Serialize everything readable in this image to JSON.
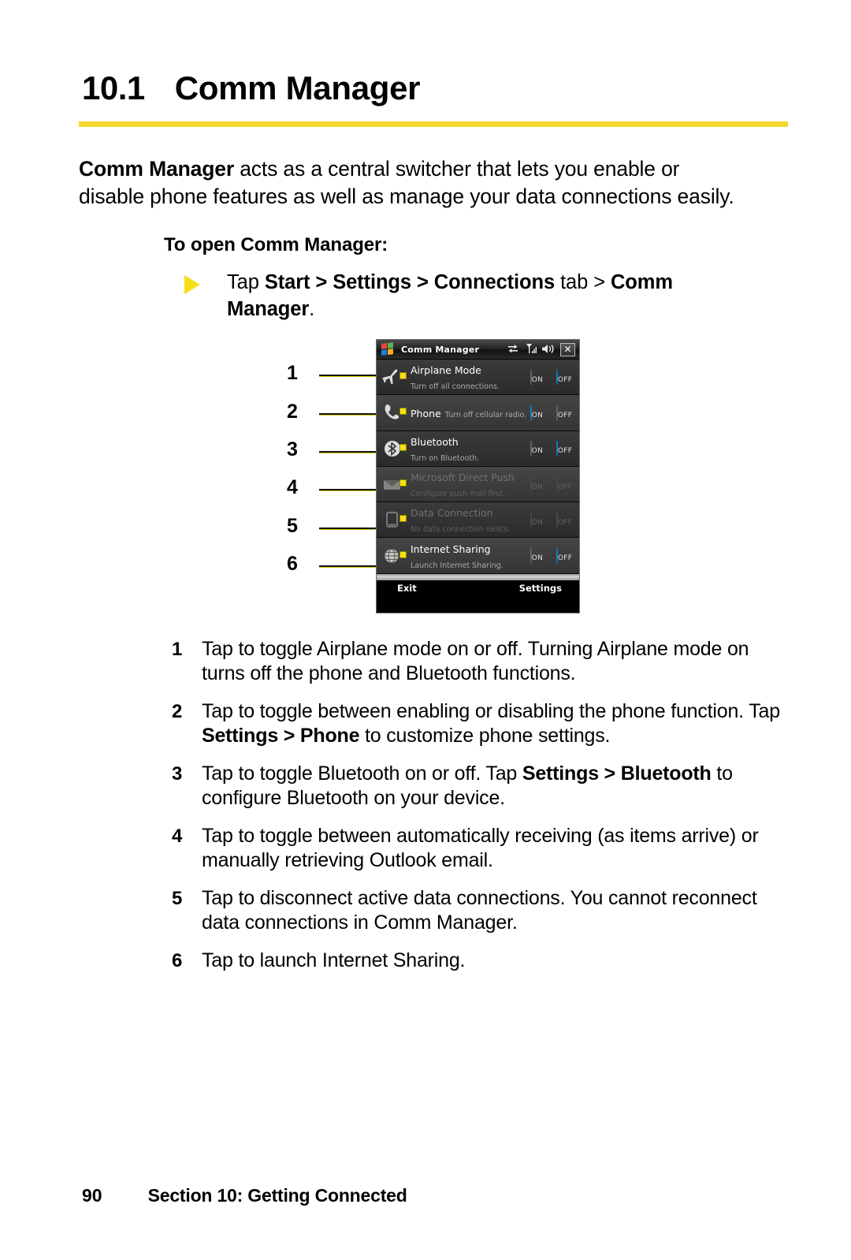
{
  "heading": {
    "number": "10.1",
    "title": "Comm Manager"
  },
  "intro": {
    "lead": "Comm Manager",
    "rest": " acts as a central switcher that lets you enable or disable phone features as well as manage your data connections easily."
  },
  "subhead": "To open Comm Manager:",
  "bullet": {
    "prefix": "Tap ",
    "b1": "Start",
    "sep1": " > ",
    "b2": "Settings",
    "sep2": " > ",
    "b3": "Connections",
    "mid": " tab > ",
    "b4": "Comm Manager",
    "suffix": "."
  },
  "callouts": [
    "1",
    "2",
    "3",
    "4",
    "5",
    "6"
  ],
  "device": {
    "titlebar": {
      "app_icon": "windows-logo-icon",
      "title": "Comm Manager",
      "tray": [
        "connectivity-icon",
        "signal-strength-icon",
        "volume-icon"
      ],
      "close_label": "✕"
    },
    "rows": [
      {
        "icon": "airplane-icon",
        "title": "Airplane Mode",
        "subtitle": "Turn off all connections.",
        "on_label": "ON",
        "off_label": "OFF",
        "state": "off",
        "disabled": false
      },
      {
        "icon": "phone-handset-icon",
        "title": "Phone",
        "subtitle": "Turn off cellular radio.",
        "on_label": "ON",
        "off_label": "OFF",
        "state": "on",
        "disabled": false
      },
      {
        "icon": "bluetooth-icon",
        "title": "Bluetooth",
        "subtitle": "Turn on Bluetooth.",
        "on_label": "ON",
        "off_label": "OFF",
        "state": "off",
        "disabled": false
      },
      {
        "icon": "envelope-icon",
        "title": "Microsoft Direct Push",
        "subtitle": "Configure push mail first.",
        "on_label": "ON",
        "off_label": "OFF",
        "state": "none",
        "disabled": true
      },
      {
        "icon": "pda-device-icon",
        "title": "Data Connection",
        "subtitle": "No data connection exists.",
        "on_label": "ON",
        "off_label": "OFF",
        "state": "none",
        "disabled": true
      },
      {
        "icon": "globe-icon",
        "title": "Internet Sharing",
        "subtitle": "Launch Internet Sharing.",
        "on_label": "ON",
        "off_label": "OFF",
        "state": "off",
        "disabled": false
      }
    ],
    "softkeys": {
      "left": "Exit",
      "right": "Settings"
    }
  },
  "steps": [
    {
      "num": "1",
      "parts": [
        {
          "t": "Tap to toggle Airplane mode on or off. Turning Airplane mode on turns off the phone and Bluetooth functions.",
          "b": false
        }
      ]
    },
    {
      "num": "2",
      "parts": [
        {
          "t": "Tap to toggle between enabling or disabling the phone function. Tap ",
          "b": false
        },
        {
          "t": "Settings > Phone",
          "b": true
        },
        {
          "t": " to customize phone settings.",
          "b": false
        }
      ]
    },
    {
      "num": "3",
      "parts": [
        {
          "t": "Tap to toggle Bluetooth on or off. Tap ",
          "b": false
        },
        {
          "t": "Settings > Bluetooth",
          "b": true
        },
        {
          "t": " to configure Bluetooth on your device.",
          "b": false
        }
      ]
    },
    {
      "num": "4",
      "parts": [
        {
          "t": "Tap to toggle between automatically receiving (as items arrive) or manually retrieving Outlook email.",
          "b": false
        }
      ]
    },
    {
      "num": "5",
      "parts": [
        {
          "t": "Tap to disconnect active data connections. You cannot reconnect data connections in Comm Manager.",
          "b": false
        }
      ]
    },
    {
      "num": "6",
      "parts": [
        {
          "t": "Tap to launch Internet Sharing.",
          "b": false
        }
      ]
    }
  ],
  "footer": {
    "page_number": "90",
    "section": "Section 10: Getting Connected"
  },
  "colors": {
    "accent_yellow": "#f2d82b",
    "bullet_yellow": "#f5e017",
    "radio_on_blue": "#0a9fe0"
  }
}
